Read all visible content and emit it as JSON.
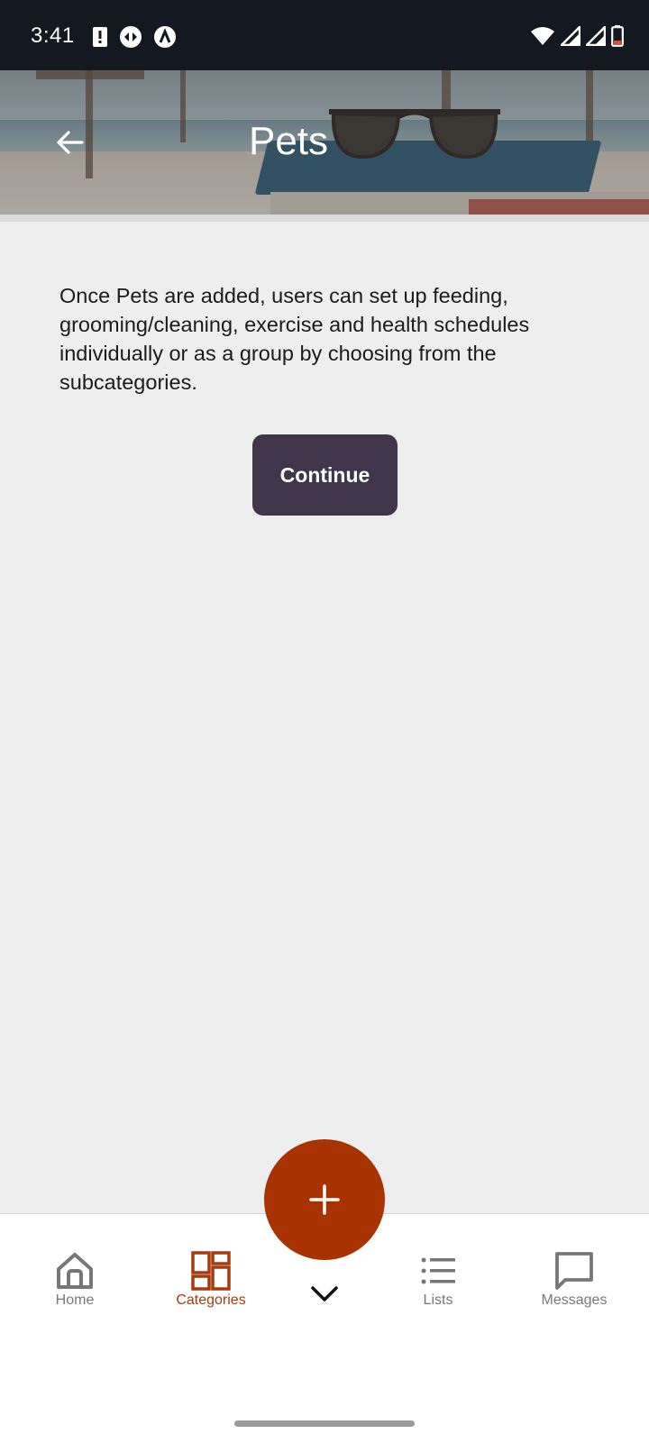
{
  "status_bar": {
    "time": "3:41",
    "left_icons": [
      "alert-icon",
      "data-saver-icon",
      "app-notification-icon"
    ],
    "right_icons": [
      "wifi-icon",
      "signal-icon",
      "signal-icon",
      "battery-icon"
    ]
  },
  "header": {
    "title": "Pets",
    "back_icon": "arrow-left-icon"
  },
  "content": {
    "description": "Once Pets are added, users can set up feeding, grooming/cleaning, exercise and health schedules individually or as a group by choosing from the subcategories.",
    "continue_label": "Continue"
  },
  "fab": {
    "icon": "plus-icon"
  },
  "bottom_nav": {
    "items": [
      {
        "label": "Home",
        "icon": "home-icon",
        "active": false
      },
      {
        "label": "Categories",
        "icon": "categories-grid-icon",
        "active": true
      },
      {
        "label": "Lists",
        "icon": "list-icon",
        "active": false
      },
      {
        "label": "Messages",
        "icon": "message-icon",
        "active": false
      }
    ],
    "expand_icon": "chevron-down-icon"
  },
  "colors": {
    "accent": "#a83300",
    "active_nav": "#a63a0f",
    "button_bg": "#40354b",
    "status_bar_bg": "#141820",
    "page_bg": "#eeeeee"
  }
}
